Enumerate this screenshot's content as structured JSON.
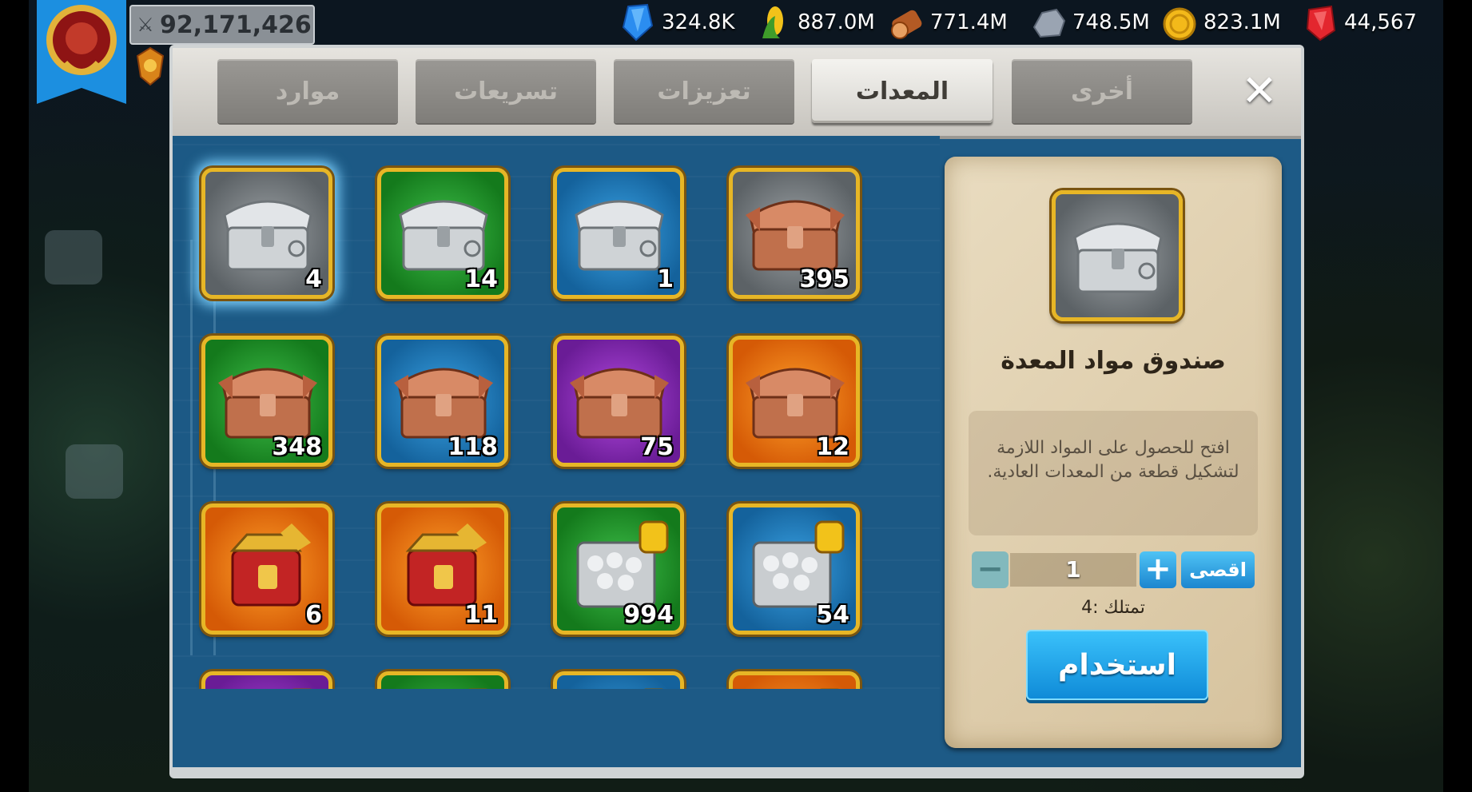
{
  "player": {
    "power": "92,171,426"
  },
  "resources": [
    {
      "name": "gems",
      "icon": "blue-gem-icon",
      "value": "324.8K",
      "color": "#3fa6ff"
    },
    {
      "name": "food",
      "icon": "corn-icon",
      "value": "887.0M",
      "color": "#f2c21a"
    },
    {
      "name": "wood",
      "icon": "log-icon",
      "value": "771.4M",
      "color": "#c2612c"
    },
    {
      "name": "stone",
      "icon": "stone-icon",
      "value": "748.5M",
      "color": "#9aa4b2"
    },
    {
      "name": "gold",
      "icon": "gold-coin-icon",
      "value": "823.1M",
      "color": "#f3b91a"
    },
    {
      "name": "premium",
      "icon": "red-gem-icon",
      "value": "44,567",
      "color": "#e3262e"
    }
  ],
  "tabs": [
    {
      "id": "other",
      "label": "أخرى",
      "active": false
    },
    {
      "id": "equipment",
      "label": "المعدات",
      "active": true
    },
    {
      "id": "boosts",
      "label": "تعزيزات",
      "active": false
    },
    {
      "id": "speedups",
      "label": "تسريعات",
      "active": false
    },
    {
      "id": "resources",
      "label": "موارد",
      "active": false
    }
  ],
  "items": [
    {
      "chest": "silver",
      "bg": "gray",
      "qty": "4",
      "selected": true
    },
    {
      "chest": "silver",
      "bg": "green",
      "qty": "14"
    },
    {
      "chest": "silver",
      "bg": "blue",
      "qty": "1"
    },
    {
      "chest": "bronze",
      "bg": "gray",
      "qty": "395"
    },
    {
      "chest": "bronze",
      "bg": "green",
      "qty": "348"
    },
    {
      "chest": "bronze",
      "bg": "blue",
      "qty": "118"
    },
    {
      "chest": "bronze",
      "bg": "purple",
      "qty": "75"
    },
    {
      "chest": "bronze",
      "bg": "orange",
      "qty": "12"
    },
    {
      "chest": "red-armor",
      "bg": "orange",
      "qty": "6"
    },
    {
      "chest": "red-armor",
      "bg": "orange",
      "qty": "11"
    },
    {
      "chest": "ore",
      "bg": "green",
      "qty": "994"
    },
    {
      "chest": "ore",
      "bg": "blue",
      "qty": "54"
    },
    {
      "chest": "ore",
      "bg": "purple",
      "qty": ""
    },
    {
      "chest": "ore",
      "bg": "green",
      "qty": ""
    },
    {
      "chest": "ore",
      "bg": "blue",
      "qty": ""
    },
    {
      "chest": "gold-ore",
      "bg": "orange",
      "qty": ""
    }
  ],
  "detail": {
    "title": "صندوق مواد المعدة",
    "description": "افتح للحصول على المواد اللازمة لتشكيل قطعة من المعدات العادية.",
    "quantity": "1",
    "max_label": "اقصى",
    "owned_label": "تمتلك :4",
    "use_label": "استخدام"
  }
}
